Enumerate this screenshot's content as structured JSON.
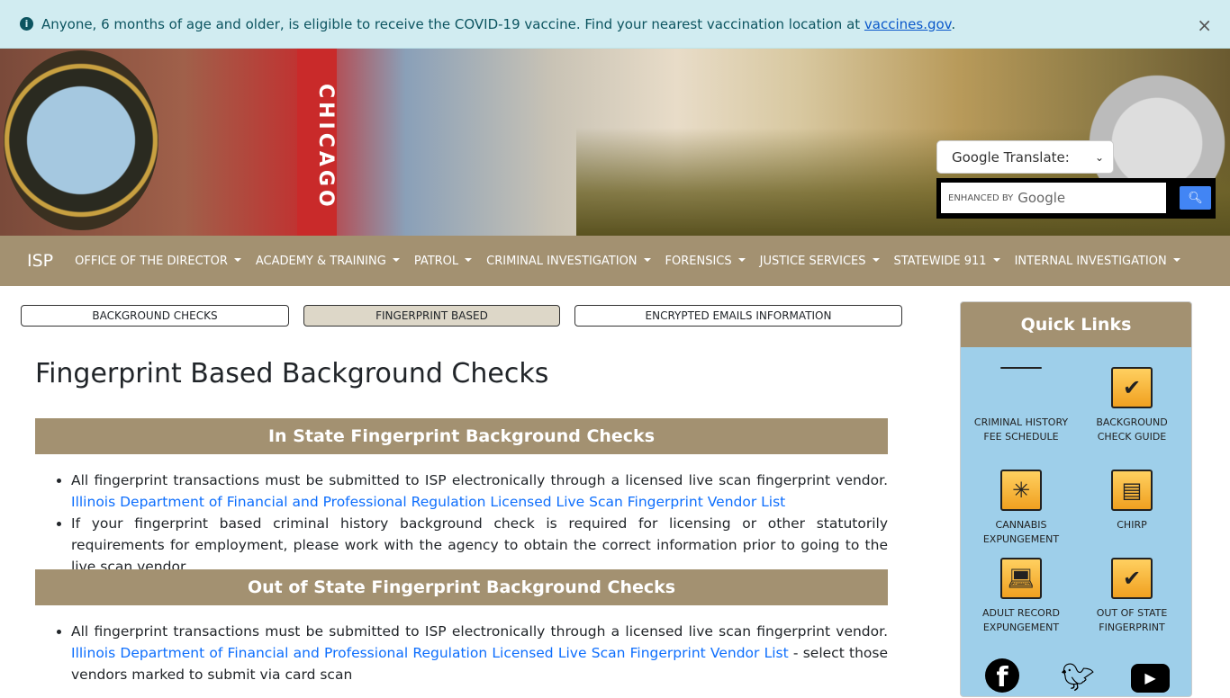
{
  "alert": {
    "text": "Anyone, 6 months of age and older, is eligible to receive the COVID-19 vaccine. Find your nearest vaccination location at ",
    "link": "vaccines.gov",
    "after": ".",
    "close": "×"
  },
  "banner": {
    "sign": "CHICAGO"
  },
  "translate": {
    "label": "Google Translate:"
  },
  "search": {
    "enhanced": "ENHANCED BY",
    "google": "Google"
  },
  "nav": {
    "brand": "ISP",
    "items": [
      "OFFICE OF THE DIRECTOR",
      "ACADEMY & TRAINING",
      "PATROL",
      "CRIMINAL INVESTIGATION",
      "FORENSICS",
      "JUSTICE SERVICES",
      "STATEWIDE 911",
      "INTERNAL INVESTIGATION"
    ]
  },
  "tabs": [
    "BACKGROUND CHECKS",
    "FINGERPRINT BASED",
    "ENCRYPTED EMAILS INFORMATION"
  ],
  "title": "Fingerprint Based Background Checks",
  "sections": [
    {
      "heading": "In State Fingerprint Background Checks",
      "items": [
        {
          "text": "All fingerprint transactions must be submitted to ISP electronically through a licensed live scan fingerprint vendor. ",
          "link": "Illinois Department of Financial and Professional Regulation Licensed Live Scan Fingerprint Vendor List",
          "after": ""
        },
        {
          "text": "If your fingerprint based criminal history background check is required for licensing or other statutorily requirements for employment, please work with the agency to obtain the correct information prior to going to the live scan vendor.",
          "link": "",
          "after": ""
        }
      ]
    },
    {
      "heading": "Out of State Fingerprint Background Checks",
      "items": [
        {
          "text": "All fingerprint transactions must be submitted to ISP electronically through a licensed live scan fingerprint vendor. ",
          "link": "Illinois Department of Financial and Professional Regulation Licensed Live Scan Fingerprint Vendor List",
          "after": " - select those vendors marked to submit via card scan"
        }
      ]
    }
  ],
  "quick_links": {
    "title": "Quick Links",
    "items": [
      "CRIMINAL HISTORY FEE SCHEDULE",
      "BACKGROUND CHECK GUIDE",
      "CANNABIS EXPUNGEMENT",
      "CHIRP",
      "ADULT RECORD EXPUNGEMENT",
      "OUT OF STATE FINGERPRINT"
    ],
    "social": [
      "facebook",
      "twitter",
      "youtube"
    ]
  },
  "colors": {
    "tan": "#a39171",
    "quick_bg": "#9ecfea",
    "alert_bg": "#d1ecf1",
    "link": "#0d6efd"
  }
}
